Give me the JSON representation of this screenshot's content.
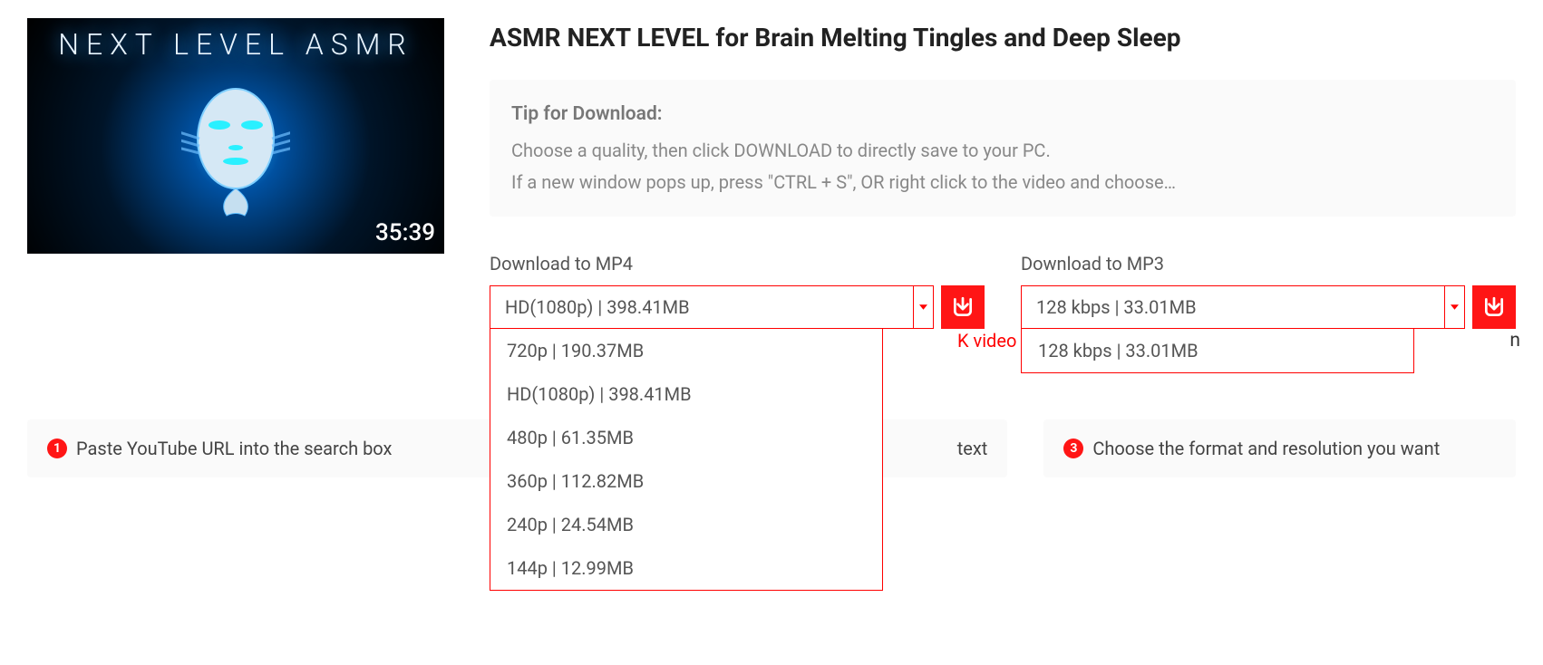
{
  "video": {
    "title": "ASMR NEXT LEVEL for Brain Melting Tingles and Deep Sleep",
    "thumb_text": "NEXT LEVEL ASMR",
    "duration": "35:39"
  },
  "tip": {
    "header": "Tip for Download:",
    "line1": "Choose a quality, then click DOWNLOAD to directly save to your PC.",
    "line2": "If a new window pops up, press \"CTRL + S\", OR right click to the video and choose…"
  },
  "mp4": {
    "label": "Download to MP4",
    "selected": "HD(1080p) | 398.41MB",
    "options": [
      "720p | 190.37MB",
      "HD(1080p) | 398.41MB",
      "480p | 61.35MB",
      "360p | 112.82MB",
      "240p | 24.54MB",
      "144p | 12.99MB"
    ]
  },
  "mp3": {
    "label": "Download to MP3",
    "selected": "128 kbps | 33.01MB",
    "options": [
      "128 kbps | 33.01MB"
    ]
  },
  "behind": {
    "red": "K video",
    "suffix_fragment": "n",
    "step2_visible": "text"
  },
  "steps": {
    "s1": "Paste YouTube URL into the search box",
    "s3": "Choose the format and resolution you want"
  }
}
